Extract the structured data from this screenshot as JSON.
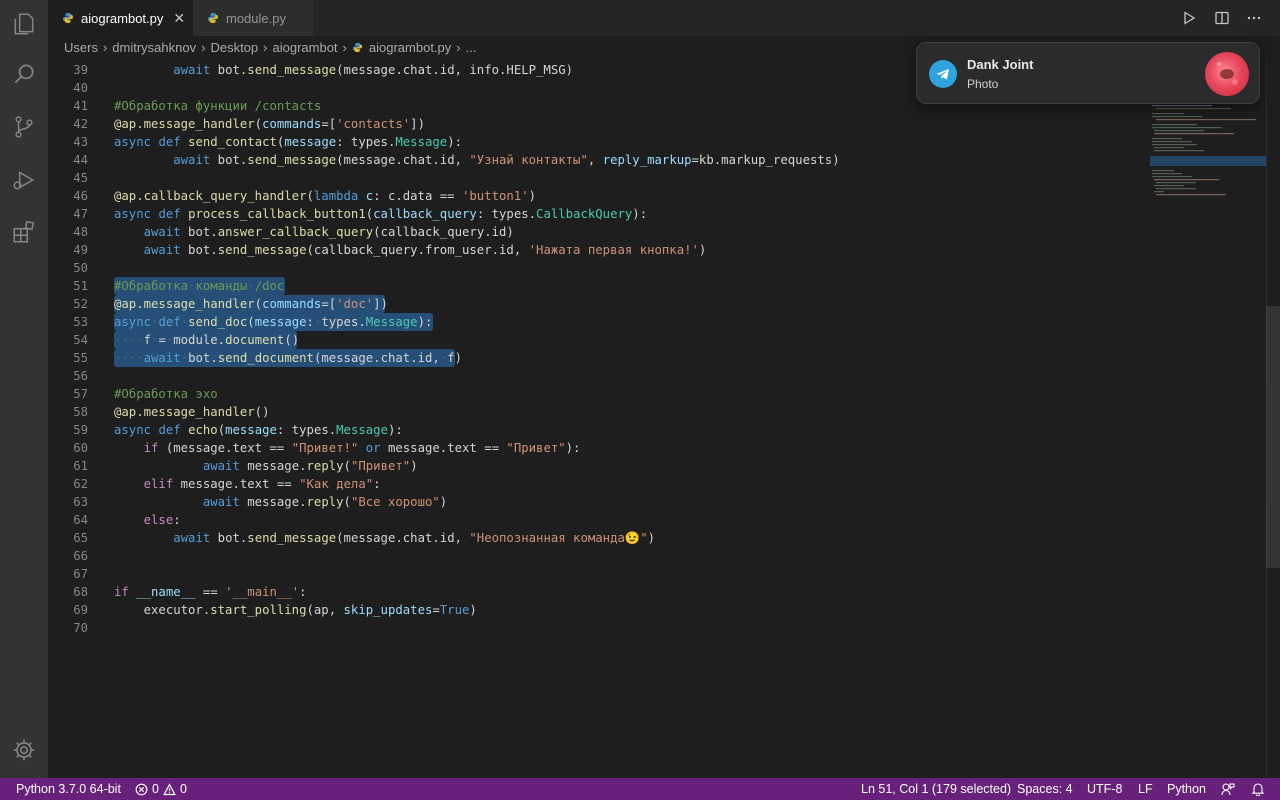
{
  "tabs": [
    {
      "label": "aiogrambot.py",
      "active": true
    },
    {
      "label": "module.py",
      "active": false
    }
  ],
  "breadcrumb": [
    "Users",
    "dmitrysahknov",
    "Desktop",
    "aiogrambot",
    "aiogrambot.py",
    "..."
  ],
  "notification": {
    "title": "Dank Joint",
    "subtitle": "Photo"
  },
  "status": {
    "interpreter": "Python 3.7.0 64-bit",
    "errors": "0",
    "warnings": "0",
    "cursor": "Ln 51, Col 1 (179 selected)",
    "spaces": "Spaces: 4",
    "encoding": "UTF-8",
    "eol": "LF",
    "language": "Python"
  },
  "editor": {
    "line_numbers": [
      "39",
      "40",
      "41",
      "42",
      "43",
      "44",
      "45",
      "46",
      "47",
      "48",
      "49",
      "50",
      "51",
      "52",
      "53",
      "54",
      "55",
      "56",
      "57",
      "58",
      "59",
      "60",
      "61",
      "62",
      "63",
      "64",
      "65",
      "66",
      "67",
      "68",
      "69",
      "70"
    ],
    "selection": {
      "start_line": "51",
      "end_line": "55",
      "selected_chars": "179"
    }
  },
  "colors": {
    "statusbar": "#68217a",
    "selection": "#264f78",
    "keyword": "#569cd6",
    "string": "#ce9178",
    "comment": "#6a9955",
    "function": "#dcdcaa"
  },
  "icons": {
    "activity": [
      "explorer-icon",
      "search-icon",
      "source-control-icon",
      "run-debug-icon",
      "extensions-icon",
      "settings-gear-icon"
    ],
    "toolbar": [
      "run-icon",
      "split-editor-icon",
      "more-actions-icon"
    ]
  }
}
